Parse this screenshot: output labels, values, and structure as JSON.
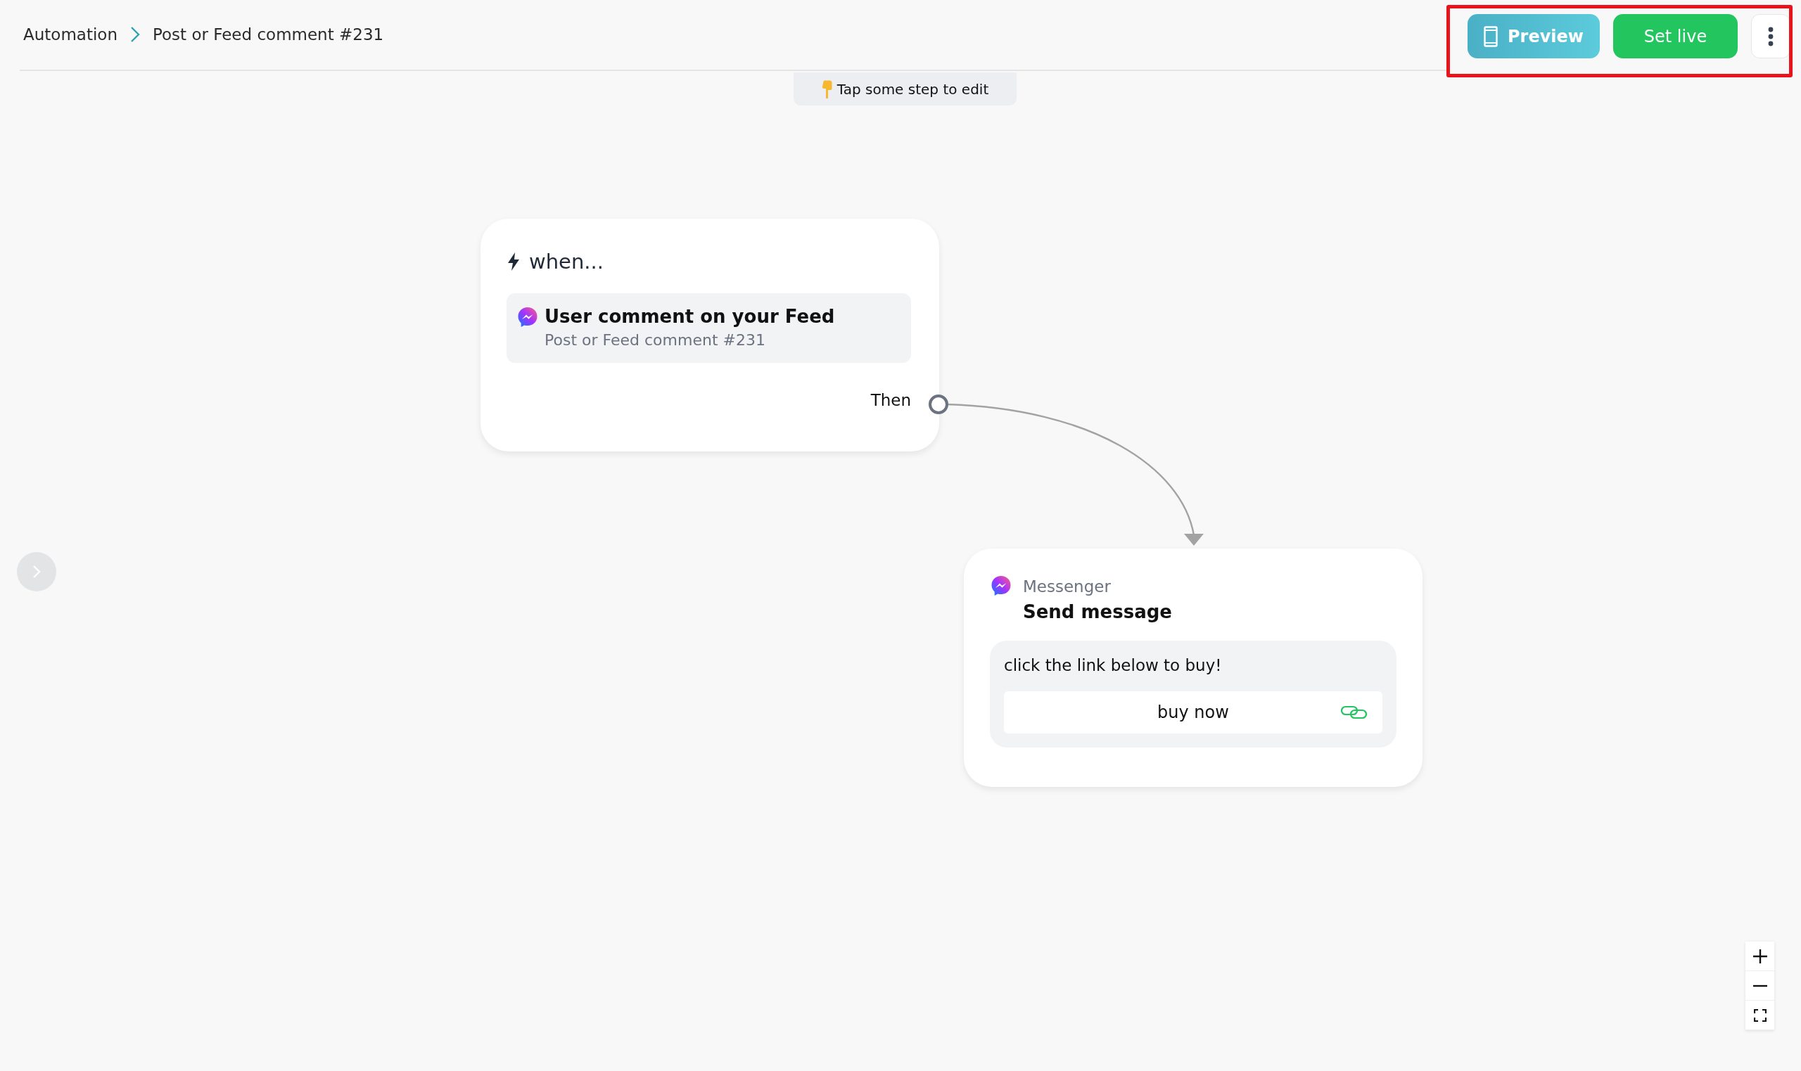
{
  "breadcrumb": [
    {
      "label": "Automation"
    },
    {
      "label": "Post or Feed comment #231"
    }
  ],
  "actions": {
    "preview": "Preview",
    "set_live": "Set live"
  },
  "hint": "Tap some step to edit",
  "nodes": [
    {
      "kind": "trigger",
      "title": "when...",
      "trigger": {
        "title": "User comment on your Feed",
        "subtitle": "Post or Feed comment #231"
      },
      "output": "Then"
    },
    {
      "kind": "action",
      "channel": "Messenger",
      "title": "Send message",
      "message": "click the link below to buy!",
      "buttons": [
        {
          "label": "buy now"
        }
      ]
    }
  ]
}
